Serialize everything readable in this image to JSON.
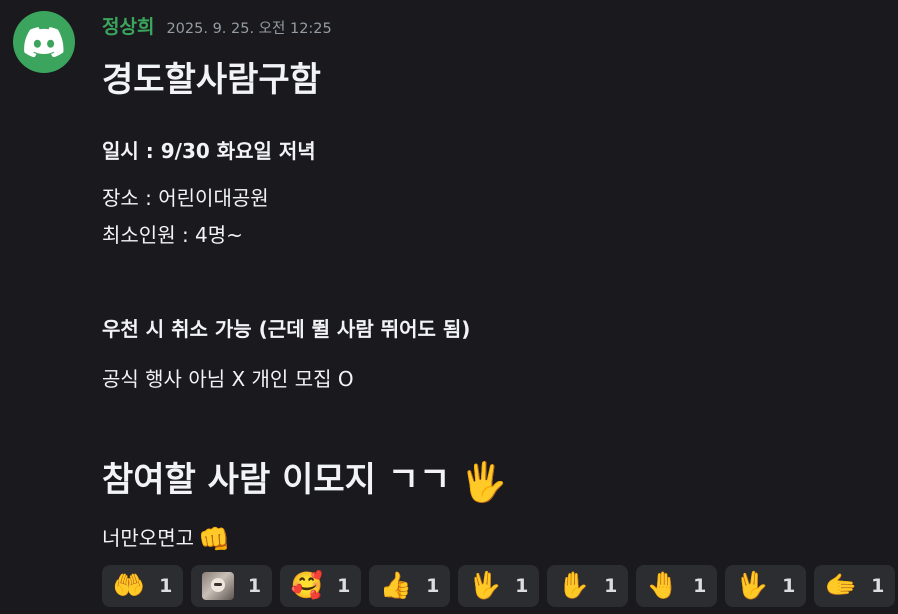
{
  "message": {
    "author": "정상희",
    "timestamp": "2025. 9. 25. 오전 12:25",
    "avatar_icon": "discord-logo-icon",
    "avatar_color": "#3ba55d",
    "title": "경도할사람구함",
    "lines": [
      "일시 : 9/30 화요일 저녁",
      "장소 : 어린이대공원",
      "최소인원 : 4명~",
      "우천 시 취소 가능 (근데 뛸 사람 뛰어도 됨)",
      "공식 행사 아님 X 개인 모집 O",
      "참여할 사람 이모지 ㄱㄱ",
      "너만오면고"
    ],
    "emoji_heading": "🖐️",
    "emoji_line": "👊"
  },
  "reactions": [
    {
      "emoji": "🤲",
      "icon": "palms-up-icon",
      "count": "1"
    },
    {
      "emoji": "",
      "icon": "cat-sticker-icon",
      "count": "1"
    },
    {
      "emoji": "🥰",
      "icon": "smiling-face-icon",
      "count": "1"
    },
    {
      "emoji": "👍",
      "icon": "thumbs-up-icon",
      "count": "1"
    },
    {
      "emoji": "🖖",
      "icon": "vulcan-salute-icon",
      "count": "1"
    },
    {
      "emoji": "✋",
      "icon": "raised-hand-icon",
      "count": "1"
    },
    {
      "emoji": "🤚",
      "icon": "raised-back-hand-icon",
      "count": "1"
    },
    {
      "emoji": "🖖",
      "icon": "vulcan-salute-icon",
      "count": "1"
    },
    {
      "emoji": "🫱",
      "icon": "rightwards-hand-icon",
      "count": "1"
    }
  ]
}
